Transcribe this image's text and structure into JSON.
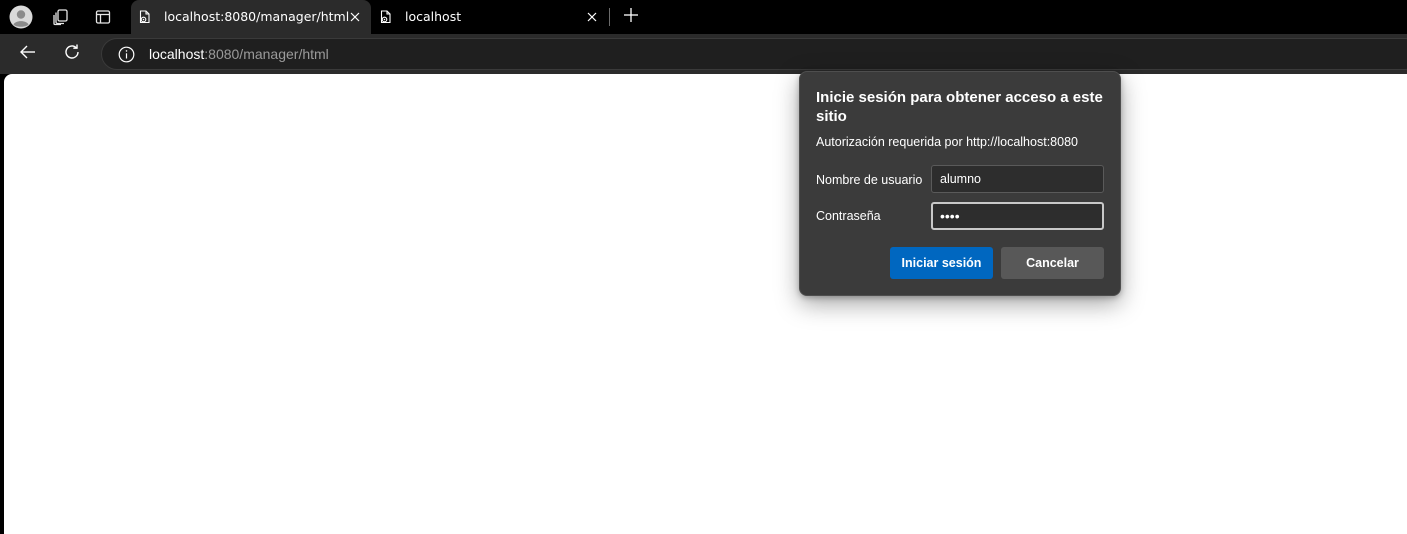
{
  "browser": {
    "tabs": [
      {
        "title": "localhost:8080/manager/html",
        "active": true,
        "favicon": "document-gear-icon"
      },
      {
        "title": "localhost",
        "active": false,
        "favicon": "document-gear-icon"
      }
    ],
    "address": {
      "host": "localhost",
      "path": ":8080/manager/html"
    },
    "icons": {
      "profile": "profile-avatar-icon",
      "workspaces": "workspaces-icon",
      "tab_actions": "tab-actions-icon",
      "new_tab": "plus-icon",
      "back": "back-arrow-icon",
      "refresh": "refresh-icon",
      "site_info": "info-icon"
    }
  },
  "auth_dialog": {
    "title": "Inicie sesión para obtener acceso a este sitio",
    "subtitle": "Autorización requerida por http://localhost:8080",
    "username_label": "Nombre de usuario",
    "username_value": "alumno",
    "password_label": "Contraseña",
    "password_value": "••••",
    "signin_label": "Iniciar sesión",
    "cancel_label": "Cancelar",
    "colors": {
      "dialog_bg": "#3b3b3b",
      "primary_button": "#0067c0",
      "secondary_button": "#585858"
    }
  }
}
